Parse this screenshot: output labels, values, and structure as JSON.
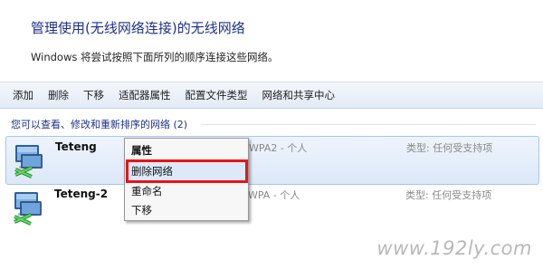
{
  "header": {
    "title": "管理使用(无线网络连接)的无线网络",
    "description": "Windows 将尝试按照下面所列的顺序连接这些网络。"
  },
  "toolbar": {
    "items": [
      "添加",
      "删除",
      "下移",
      "适配器属性",
      "配置文件类型",
      "网络和共享中心"
    ]
  },
  "section": {
    "header": "您可以查看、修改和重新排序的网络 (2)"
  },
  "networks": [
    {
      "name": "Teteng",
      "security": "WPA2 - 个人",
      "type": "类型: 任何受支持项",
      "selected": true
    },
    {
      "name": "Teteng-2",
      "security": "WPA - 个人",
      "type": "类型: 任何受支持项",
      "selected": false
    }
  ],
  "context_menu": {
    "items": [
      "属性",
      "删除网络",
      "重命名",
      "下移"
    ],
    "highlighted": "删除网络"
  },
  "watermark": "www.192ly.com",
  "colors": {
    "title": "#1e3287",
    "highlight_box": "#e8141a",
    "selection": "#dce8f8"
  }
}
